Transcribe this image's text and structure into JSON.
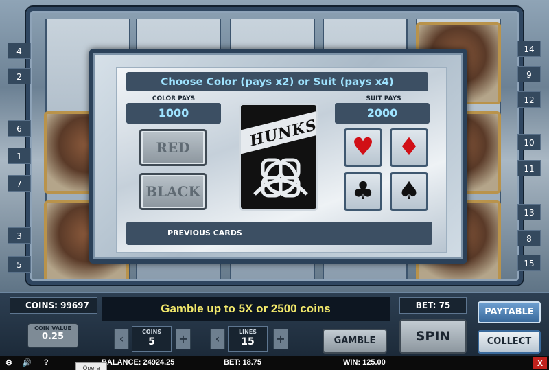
{
  "dialog": {
    "title": "Choose Color (pays x2) or Suit (pays x4)",
    "color_pays_label": "COLOR PAYS",
    "color_pays_value": "1000",
    "suit_pays_label": "SUIT PAYS",
    "suit_pays_value": "2000",
    "red_label": "RED",
    "black_label": "BLACK",
    "suits": [
      {
        "name": "hearts",
        "glyph": "♥",
        "color": "#d10f16"
      },
      {
        "name": "diamonds",
        "glyph": "♦",
        "color": "#d10f16"
      },
      {
        "name": "clubs",
        "glyph": "♣",
        "color": "#111111"
      },
      {
        "name": "spades",
        "glyph": "♠",
        "color": "#111111"
      }
    ],
    "card_logo": "HUNKS",
    "previous_cards_label": "PREVIOUS CARDS"
  },
  "paylines": {
    "left": [
      "4",
      "2",
      "6",
      "1",
      "7",
      "3",
      "5"
    ],
    "right": [
      "14",
      "9",
      "12",
      "10",
      "11",
      "13",
      "8",
      "15"
    ]
  },
  "panel": {
    "coins": "COINS: 99697",
    "message": "Gamble up to 5X or 2500 coins",
    "bet": "BET: 75",
    "paytable_label": "PAYTABLE",
    "coin_value_label": "COIN VALUE",
    "coin_value": "0.25",
    "coins_label": "COINS",
    "coins_value": "5",
    "lines_label": "LINES",
    "lines_value": "15",
    "gamble_label": "GAMBLE",
    "spin_label": "SPIN",
    "collect_label": "COLLECT"
  },
  "footer": {
    "balance": "BALANCE: 24924.25",
    "bet": "BET: 18.75",
    "win": "WIN: 125.00",
    "help": "?",
    "opera_tab": "Opera",
    "close": "X"
  },
  "colors": {
    "accent_text": "#9fe3ff",
    "message_text": "#f2e86b",
    "blue_button": "#3a6a9c",
    "close_red": "#c0221d"
  }
}
